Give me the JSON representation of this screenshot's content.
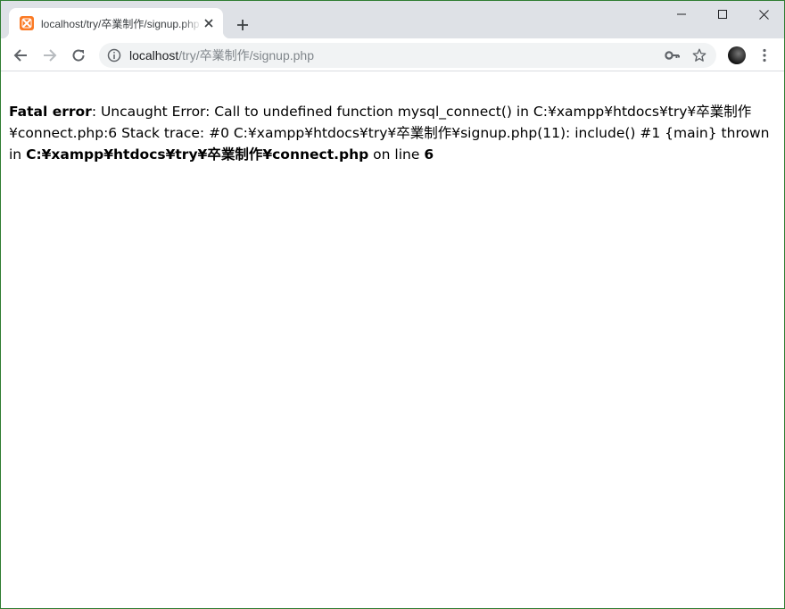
{
  "browser": {
    "tab": {
      "title": "localhost/try/卒業制作/signup.php",
      "favicon": "xampp-icon"
    },
    "address": {
      "host": "localhost",
      "path": "/try/卒業制作/signup.php"
    },
    "icons": {
      "back": "back-arrow-icon",
      "forward": "forward-arrow-icon",
      "reload": "reload-icon",
      "site_info": "info-icon",
      "password_key": "key-icon",
      "bookmark": "star-icon",
      "menu": "kebab-menu-icon",
      "new_tab": "plus-icon",
      "close_tab": "close-icon",
      "minimize": "minimize-icon",
      "maximize": "maximize-icon",
      "close_window": "close-icon"
    },
    "colors": {
      "tabstrip": "#dee1e6",
      "favicon": "#fb7a24",
      "window_border": "#2f7d32"
    }
  },
  "page": {
    "error": {
      "label": "Fatal error",
      "message": ": Uncaught Error: Call to undefined function mysql_connect() in C:¥xampp¥htdocs¥try¥卒業制作¥connect.php:6 Stack trace: #0 C:¥xampp¥htdocs¥try¥卒業制作¥signup.php(11): include() #1 {main} thrown in ",
      "file": "C:¥xampp¥htdocs¥try¥卒業制作¥connect.php",
      "on_line": " on line ",
      "line": "6"
    }
  }
}
